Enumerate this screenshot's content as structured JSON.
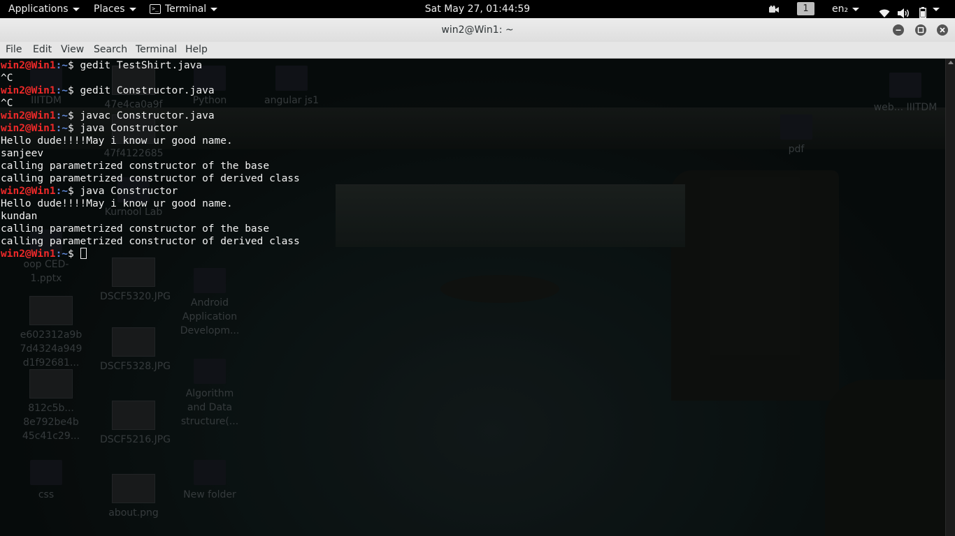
{
  "topbar": {
    "applications": "Applications",
    "places": "Places",
    "terminal_app": "Terminal",
    "clock": "Sat May 27, 01:44:59",
    "workspace": "1",
    "language": "en₂"
  },
  "window": {
    "title": "win2@Win1: ~"
  },
  "menubar": {
    "items": [
      "File",
      "Edit",
      "View",
      "Search",
      "Terminal",
      "Help"
    ]
  },
  "terminal": {
    "prompt_user": "win2@Win1",
    "prompt_path": ":~",
    "prompt_symbol": "$ ",
    "lines": [
      {
        "type": "prompt",
        "cmd": "gedit TestShirt.java"
      },
      {
        "type": "output",
        "text": "^C"
      },
      {
        "type": "prompt",
        "cmd": "gedit Constructor.java"
      },
      {
        "type": "output",
        "text": "^C"
      },
      {
        "type": "prompt",
        "cmd": "javac Constructor.java"
      },
      {
        "type": "prompt",
        "cmd": "java Constructor"
      },
      {
        "type": "output",
        "text": "Hello dude!!!!May i know ur good name."
      },
      {
        "type": "output",
        "text": "sanjeev"
      },
      {
        "type": "output",
        "text": "calling parametrized constructor of the base"
      },
      {
        "type": "output",
        "text": "calling parametrized constructor of derived class"
      },
      {
        "type": "prompt",
        "cmd": "java Constructor"
      },
      {
        "type": "output",
        "text": "Hello dude!!!!May i know ur good name."
      },
      {
        "type": "output",
        "text": "kundan"
      },
      {
        "type": "output",
        "text": "calling parametrized constructor of the base"
      },
      {
        "type": "output",
        "text": "calling parametrized constructor of derived class"
      },
      {
        "type": "prompt",
        "cmd": "",
        "cursor": true
      }
    ]
  },
  "desktop_icons": [
    {
      "name": "IIITDM",
      "kind": "folder"
    },
    {
      "name": "47e4ca0a9f",
      "kind": "thumb"
    },
    {
      "name": "Python",
      "kind": "folder"
    },
    {
      "name": "angular js1",
      "kind": "folder"
    },
    {
      "name": "web... IIITDM",
      "kind": "folder"
    },
    {
      "name": "pdf",
      "kind": "folder"
    },
    {
      "name": "47f4122685",
      "kind": "thumb"
    },
    {
      "name": "Kurnool Lab",
      "kind": "folder"
    },
    {
      "name": "oop CED-1.pptx",
      "kind": "file"
    },
    {
      "name": "DSCF5320.JPG",
      "kind": "thumb"
    },
    {
      "name": "Android Application Developm...",
      "kind": "folder"
    },
    {
      "name": "e602312a9b 7d4324a949 d1f92681...",
      "kind": "thumb"
    },
    {
      "name": "DSCF5328.JPG",
      "kind": "thumb"
    },
    {
      "name": "812c5b... 8e792be4b 45c41c29...",
      "kind": "thumb"
    },
    {
      "name": "Algorithm and Data structure(...",
      "kind": "folder"
    },
    {
      "name": "DSCF5216.JPG",
      "kind": "thumb"
    },
    {
      "name": "css",
      "kind": "folder"
    },
    {
      "name": "about.png",
      "kind": "thumb"
    },
    {
      "name": "New folder",
      "kind": "folder"
    }
  ]
}
